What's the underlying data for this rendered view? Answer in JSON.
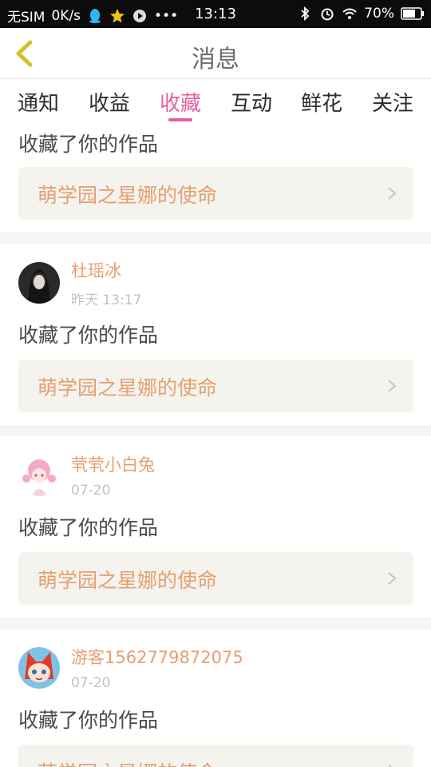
{
  "statusbar": {
    "carrier": "无SIM",
    "speed": "0K/s",
    "time": "13:13",
    "battery": "70%"
  },
  "nav": {
    "title": "消息"
  },
  "tabs": [
    {
      "label": "通知"
    },
    {
      "label": "收益"
    },
    {
      "label": "收藏",
      "active": true
    },
    {
      "label": "互动"
    },
    {
      "label": "鲜花"
    },
    {
      "label": "关注"
    }
  ],
  "feed": [
    {
      "user": "",
      "time": "",
      "message": "收藏了你的作品",
      "work": "萌学园之星娜的使命"
    },
    {
      "user": "杜瑶冰",
      "time": "昨天 13:17",
      "message": "收藏了你的作品",
      "work": "萌学园之星娜的使命"
    },
    {
      "user": "茕茕小白兔",
      "time": "07-20",
      "message": "收藏了你的作品",
      "work": "萌学园之星娜的使命"
    },
    {
      "user": "游客1562779872075",
      "time": "07-20",
      "message": "收藏了你的作品",
      "work": "萌学园之星娜的使命"
    }
  ],
  "colors": {
    "accent": "#e55fa0",
    "name": "#e6a072",
    "back": "#d8bf2a"
  }
}
